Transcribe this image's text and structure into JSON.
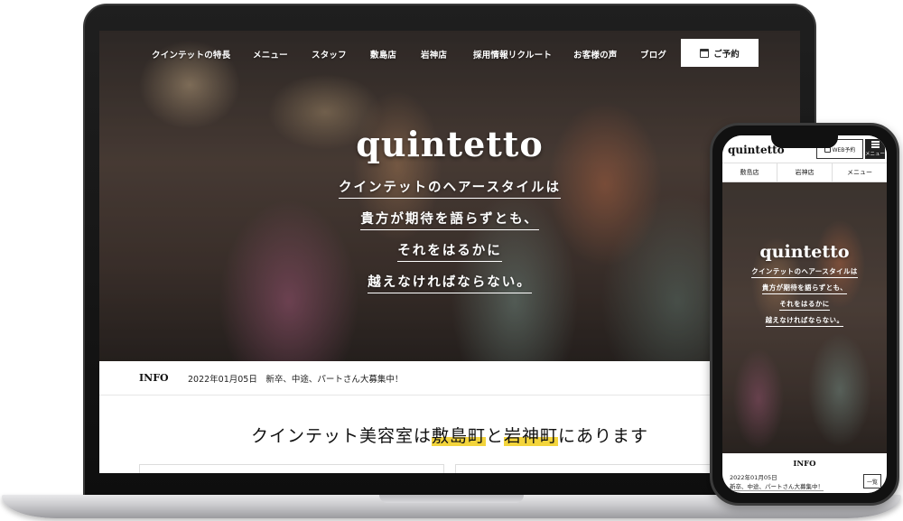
{
  "laptop": {
    "nav": {
      "items": [
        "クインテットの特長",
        "メニュー",
        "スタッフ",
        "敷島店",
        "岩神店",
        "採用情報リクルート",
        "お客様の声",
        "ブログ"
      ],
      "reserve_label": "ご予約"
    },
    "hero": {
      "logo": "quintetto",
      "catch_lines": [
        "クインテットのヘアースタイルは",
        "貴方が期待を語らずとも、",
        "それをはるかに",
        "越えなければならない。"
      ]
    },
    "info": {
      "label": "INFO",
      "text": "2022年01月05日　新卒、中途、パートさん大募集中！"
    },
    "headline": {
      "prefix": "クインテット美容室は",
      "place1": "敷島町",
      "middle": "と",
      "place2": "岩神町",
      "suffix": "にあります"
    }
  },
  "phone": {
    "logo": "quintetto",
    "reserve_label": "WEB予約",
    "menu_label": "メニュー",
    "subnav": [
      "敷島店",
      "岩神店",
      "メニュー"
    ],
    "hero": {
      "logo": "quintetto",
      "catch_lines": [
        "クインテットのヘアースタイルは",
        "貴方が期待を語らずとも、",
        "それをはるかに",
        "越えなければならない。"
      ]
    },
    "info": {
      "label": "INFO",
      "date": "2022年01月05日",
      "text": "新卒、中途、パートさん大募集中！",
      "list_label": "一覧"
    }
  },
  "colors": {
    "highlight": "#f3d43b",
    "device_frame": "#111111"
  }
}
